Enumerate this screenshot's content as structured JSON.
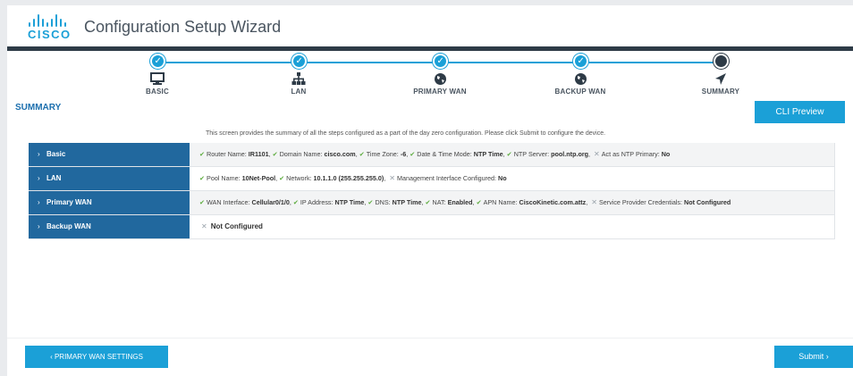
{
  "header": {
    "logo_text": "CISCO",
    "app_title": "Configuration Setup Wizard",
    "brand_color": "#1ba0d7",
    "dark_color": "#2e3b47"
  },
  "steps": [
    {
      "label": "BASIC",
      "icon": "monitor-icon",
      "state": "done"
    },
    {
      "label": "LAN",
      "icon": "network-icon",
      "state": "done"
    },
    {
      "label": "PRIMARY WAN",
      "icon": "globe-icon",
      "state": "done"
    },
    {
      "label": "BACKUP WAN",
      "icon": "globe-icon",
      "state": "done"
    },
    {
      "label": "SUMMARY",
      "icon": "navigation-arrow-icon",
      "state": "current"
    }
  ],
  "summary": {
    "title": "SUMMARY",
    "cli_preview_label": "CLI Preview",
    "intro": "This screen provides the summary of all the steps configured as a part of the day zero configuration. Please click Submit to configure the device.",
    "rows": [
      {
        "heading": "Basic",
        "items": [
          {
            "ok": true,
            "label": "Router Name:",
            "value": "IR1101"
          },
          {
            "ok": true,
            "label": "Domain Name:",
            "value": "cisco.com"
          },
          {
            "ok": true,
            "label": "Time Zone:",
            "value": "-6"
          },
          {
            "ok": true,
            "label": "Date & Time Mode:",
            "value": "NTP Time"
          },
          {
            "ok": true,
            "label": "NTP Server:",
            "value": "pool.ntp.org"
          },
          {
            "ok": false,
            "label": "Act as NTP Primary:",
            "value": "No"
          }
        ]
      },
      {
        "heading": "LAN",
        "items": [
          {
            "ok": true,
            "label": "Pool Name:",
            "value": "10Net-Pool"
          },
          {
            "ok": true,
            "label": "Network:",
            "value": "10.1.1.0 (255.255.255.0)"
          },
          {
            "ok": false,
            "label": "Management Interface Configured:",
            "value": "No"
          }
        ]
      },
      {
        "heading": "Primary WAN",
        "items": [
          {
            "ok": true,
            "label": "WAN Interface:",
            "value": "Cellular0/1/0"
          },
          {
            "ok": true,
            "label": "IP Address:",
            "value": "NTP Time"
          },
          {
            "ok": true,
            "label": "DNS:",
            "value": "NTP Time"
          },
          {
            "ok": true,
            "label": "NAT:",
            "value": "Enabled"
          },
          {
            "ok": true,
            "label": "APN Name:",
            "value": "CiscoKinetic.com.attz"
          },
          {
            "ok": false,
            "label": "Service Provider Credentials:",
            "value": "Not Configured"
          }
        ]
      },
      {
        "heading": "Backup WAN",
        "items": [
          {
            "ok": false,
            "label": "",
            "value": "Not Configured"
          }
        ]
      }
    ]
  },
  "footer": {
    "back_label": "‹ PRIMARY WAN SETTINGS",
    "submit_label": "Submit ›"
  }
}
